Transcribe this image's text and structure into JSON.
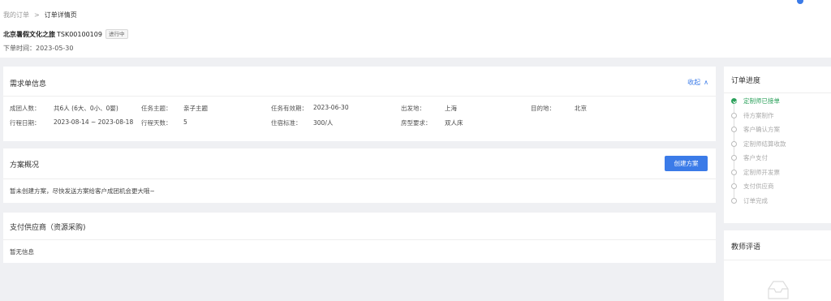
{
  "breadcrumb": {
    "parent": "我的订单",
    "separator": ">",
    "current": "订单详情页"
  },
  "order": {
    "name": "北京暑假文化之旅",
    "code": "TSK00100109",
    "status": "进行中",
    "created": "下单时间：2023-05-30"
  },
  "requirements": {
    "title": "需求单信息",
    "collapse_label": "收起",
    "fields": [
      {
        "label": "成团人数：",
        "value": "共6人 (6大、0小、0婴)"
      },
      {
        "label": "任务主题：",
        "value": "亲子主题"
      },
      {
        "label": "任务有效期：",
        "value": "2023-06-30"
      },
      {
        "label": "出发地：",
        "value": "上海"
      },
      {
        "label": "目的地：",
        "value": "北京"
      },
      {
        "label": "行程日期：",
        "value": "2023-08-14 ~ 2023-08-18"
      },
      {
        "label": "行程天数：",
        "value": "5"
      },
      {
        "label": "住宿标准：",
        "value": "300/人"
      },
      {
        "label": "房型要求：",
        "value": "双人床"
      }
    ]
  },
  "plan": {
    "title": "方案概况",
    "create_label": "创建方案",
    "message": "暂未创建方案，尽快发送方案给客户成团机会更大哦~"
  },
  "supplier": {
    "title": "支付供应商（资源采购)",
    "message": "暂无信息"
  },
  "progress": {
    "title": "订单进度",
    "steps": [
      {
        "label": "定制师已接单",
        "active": true
      },
      {
        "label": "待方案制作",
        "active": false
      },
      {
        "label": "客户确认方案",
        "active": false
      },
      {
        "label": "定制师结算收款",
        "active": false
      },
      {
        "label": "客户支付",
        "active": false
      },
      {
        "label": "定制师开发票",
        "active": false
      },
      {
        "label": "支付供应商",
        "active": false
      },
      {
        "label": "订单完成",
        "active": false
      }
    ]
  },
  "review": {
    "title": "教师评语",
    "icon": "empty-inbox-icon"
  },
  "colors": {
    "accent": "#3b7be8",
    "success": "#2aa05a",
    "background": "#eff0f3"
  }
}
